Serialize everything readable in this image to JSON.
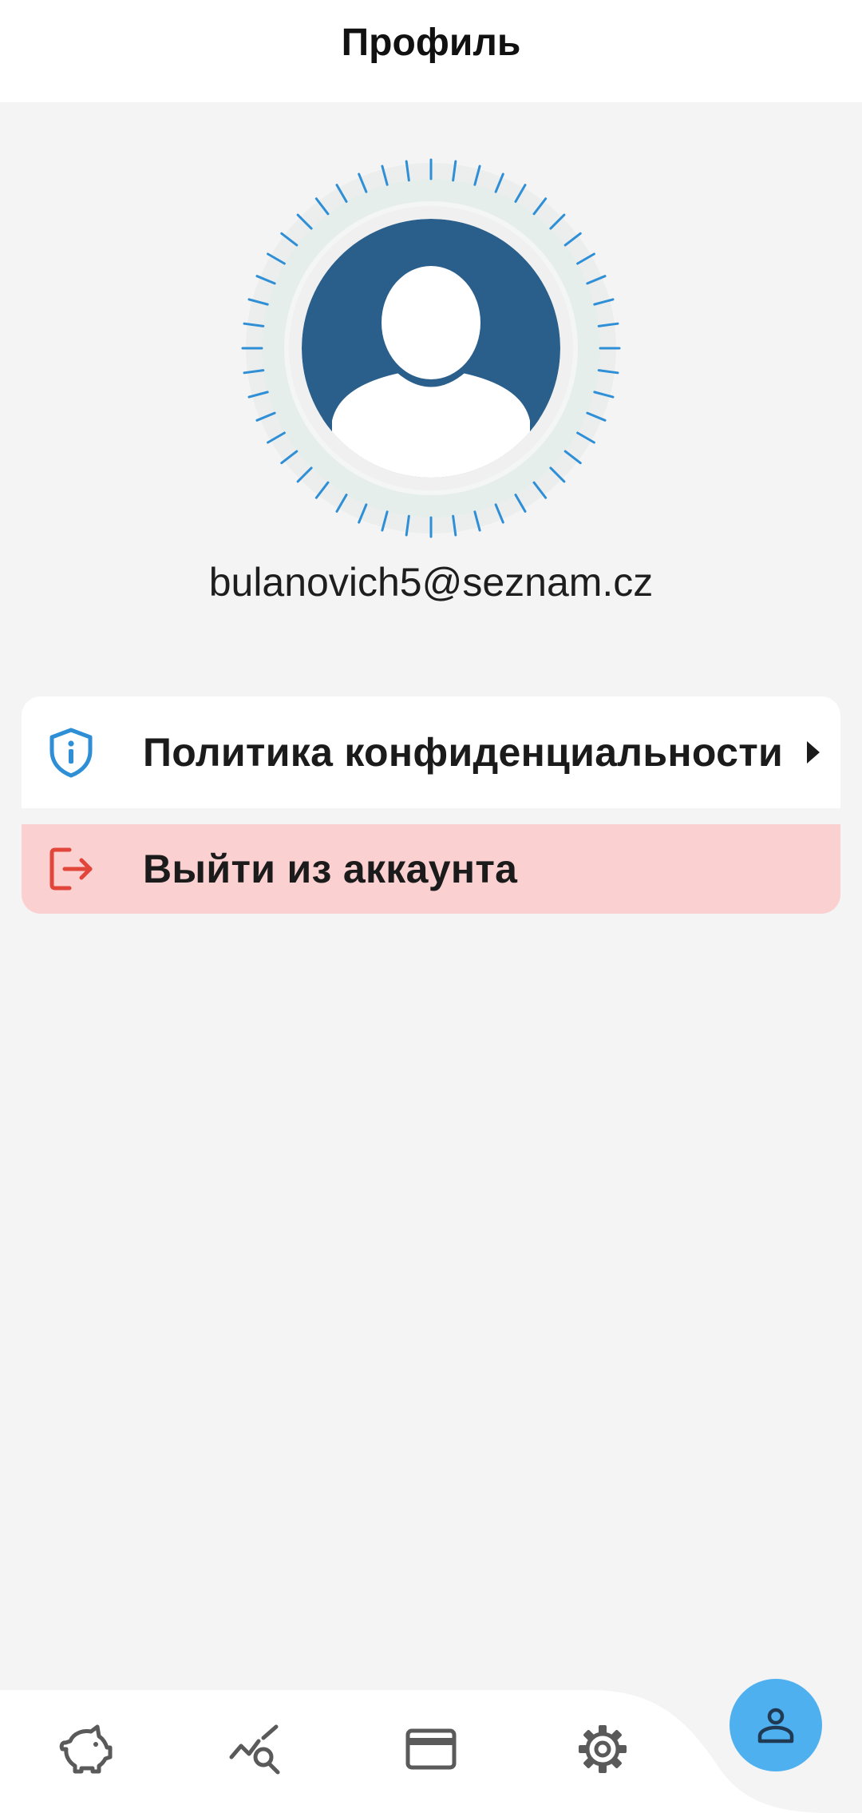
{
  "header": {
    "title": "Профиль"
  },
  "profile": {
    "avatar_icon": "user-avatar-icon",
    "email": "bulanovich5@seznam.cz"
  },
  "menu": {
    "items": [
      {
        "label": "Политика конфиденциальности",
        "icon": "shield-info-icon",
        "arrow": "chevron-right-icon"
      },
      {
        "label": "Выйти из аккаунта",
        "icon": "logout-icon"
      }
    ]
  },
  "bottom_nav": {
    "items": [
      {
        "icon": "piggy-bank-icon"
      },
      {
        "icon": "chart-search-icon"
      },
      {
        "icon": "credit-card-icon"
      },
      {
        "icon": "gear-icon"
      },
      {
        "icon": "person-icon",
        "active": true
      }
    ]
  },
  "colors": {
    "background": "#f4f4f4",
    "avatar": "#2a5f8c",
    "accent": "#2e8fd6",
    "fab": "#4fb0f0",
    "logout_bg": "#fbd0d0",
    "logout_icon": "#e2453a",
    "nav_icon": "#5a5a5a"
  }
}
